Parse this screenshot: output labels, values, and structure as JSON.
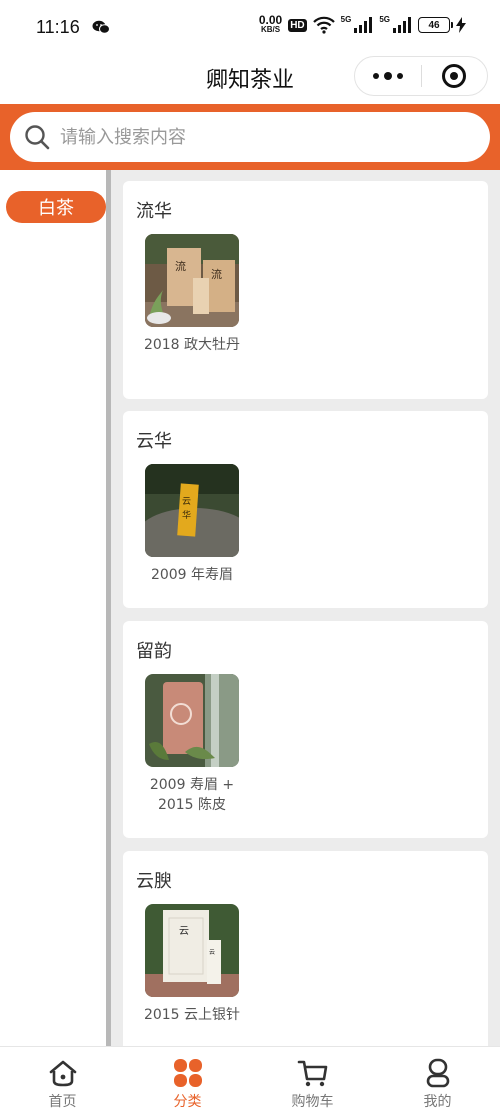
{
  "status_bar": {
    "time": "11:16",
    "net_speed_value": "0.00",
    "net_speed_unit": "KB/S",
    "hd": "HD",
    "sig1": "5G",
    "sig2": "5G",
    "battery": "46"
  },
  "nav": {
    "title": "卿知茶业",
    "more_icon": "more-dots-icon",
    "close_icon": "target-icon"
  },
  "search": {
    "placeholder": "请输入搜索内容",
    "icon": "search-icon"
  },
  "sidebar": {
    "items": [
      {
        "label": "白茶",
        "selected": true
      }
    ]
  },
  "categories": [
    {
      "title": "流华",
      "products": [
        {
          "name": "2018 政大牡丹"
        }
      ]
    },
    {
      "title": "云华",
      "products": [
        {
          "name": "2009 年寿眉"
        }
      ]
    },
    {
      "title": "留韵",
      "products": [
        {
          "name": "2009 寿眉 + 2015 陈皮"
        }
      ]
    },
    {
      "title": "云腴",
      "products": [
        {
          "name": "2015 云上银针"
        }
      ]
    }
  ],
  "tab_bar": {
    "items": [
      {
        "label": "首页",
        "icon": "home-icon",
        "active": false
      },
      {
        "label": "分类",
        "icon": "category-icon",
        "active": true
      },
      {
        "label": "购物车",
        "icon": "cart-icon",
        "active": false
      },
      {
        "label": "我的",
        "icon": "profile-icon",
        "active": false
      }
    ]
  },
  "colors": {
    "accent": "#e8622a",
    "background": "#ececec"
  }
}
